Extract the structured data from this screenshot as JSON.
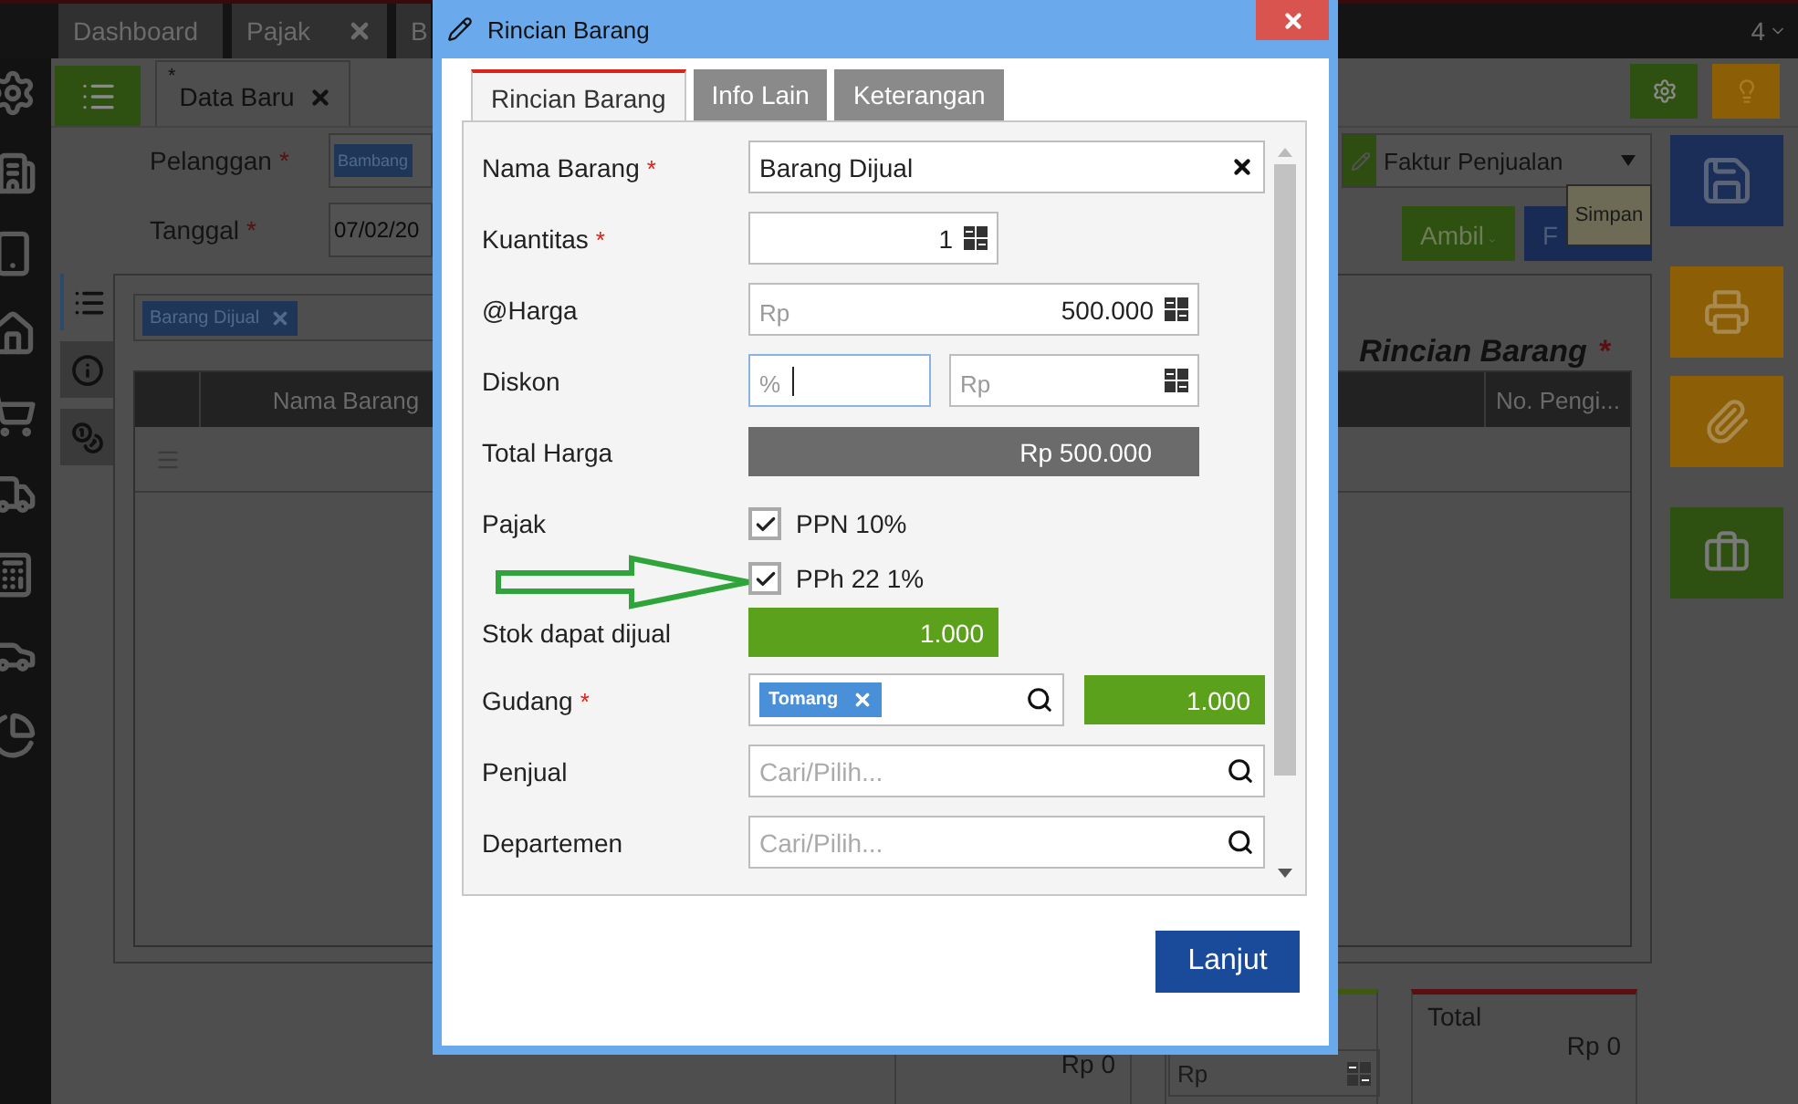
{
  "required_mark": "*",
  "top_tabs": [
    {
      "label": "Dashboard",
      "closable": false
    },
    {
      "label": "Pajak",
      "closable": true
    },
    {
      "label": "B"
    }
  ],
  "top_counter": "4",
  "doc_tab": {
    "marker": "*",
    "label": "Data Baru"
  },
  "form": [
    {
      "label": "Pelanggan",
      "required": true,
      "kind": "tag",
      "value": "Bambang"
    },
    {
      "label": "Tanggal",
      "required": true,
      "kind": "text",
      "value": "07/02/20"
    }
  ],
  "invoice_type": "Faktur Penjualan",
  "tooltip": "Simpan",
  "actions": [
    {
      "label": "Ambil",
      "kind": "green"
    },
    {
      "label": "F",
      "kind": "navy"
    }
  ],
  "side_tabs": [
    {
      "selected": true
    },
    {
      "selected": false
    },
    {
      "selected": false
    }
  ],
  "filter_tag": "Barang Dijual",
  "section_title": "Rincian Barang",
  "table": {
    "columns": [
      "Nama Barang",
      "No. Pengi..."
    ]
  },
  "summary": {
    "subtotal": "Rp 0",
    "amount_placeholder": "Rp",
    "total_label": "Total",
    "total_value": "Rp 0"
  },
  "dialog": {
    "title": "Rincian Barang",
    "tabs": [
      {
        "label": "Rincian Barang",
        "selected": true
      },
      {
        "label": "Info Lain",
        "selected": false
      },
      {
        "label": "Keterangan",
        "selected": false
      }
    ],
    "fields": [
      {
        "kind": "select",
        "label": "Nama Barang",
        "required": true,
        "value": "Barang Dijual"
      },
      {
        "kind": "number",
        "label": "Kuantitas",
        "required": true,
        "value": "1"
      },
      {
        "kind": "money",
        "label": "@Harga",
        "required": false,
        "prefix": "Rp",
        "value": "500.000"
      },
      {
        "kind": "discount",
        "label": "Diskon",
        "required": false,
        "percent_prefix": "%",
        "amount_prefix": "Rp",
        "focused": true
      },
      {
        "kind": "total",
        "label": "Total Harga",
        "required": false,
        "value": "Rp 500.000"
      },
      {
        "kind": "checks",
        "label": "Pajak",
        "required": false,
        "options": [
          {
            "label": "PPN 10%",
            "checked": true
          },
          {
            "label": "PPh 22 1%",
            "checked": true
          }
        ]
      },
      {
        "kind": "readout",
        "label": "Stok dapat dijual",
        "required": false,
        "value": "1.000"
      },
      {
        "kind": "warehouse",
        "label": "Gudang",
        "required": true,
        "tag": "Tomang",
        "stock": "1.000"
      },
      {
        "kind": "search",
        "label": "Penjual",
        "required": false,
        "placeholder": "Cari/Pilih..."
      },
      {
        "kind": "search",
        "label": "Departemen",
        "required": false,
        "placeholder": "Cari/Pilih..."
      }
    ],
    "button": "Lanjut"
  }
}
